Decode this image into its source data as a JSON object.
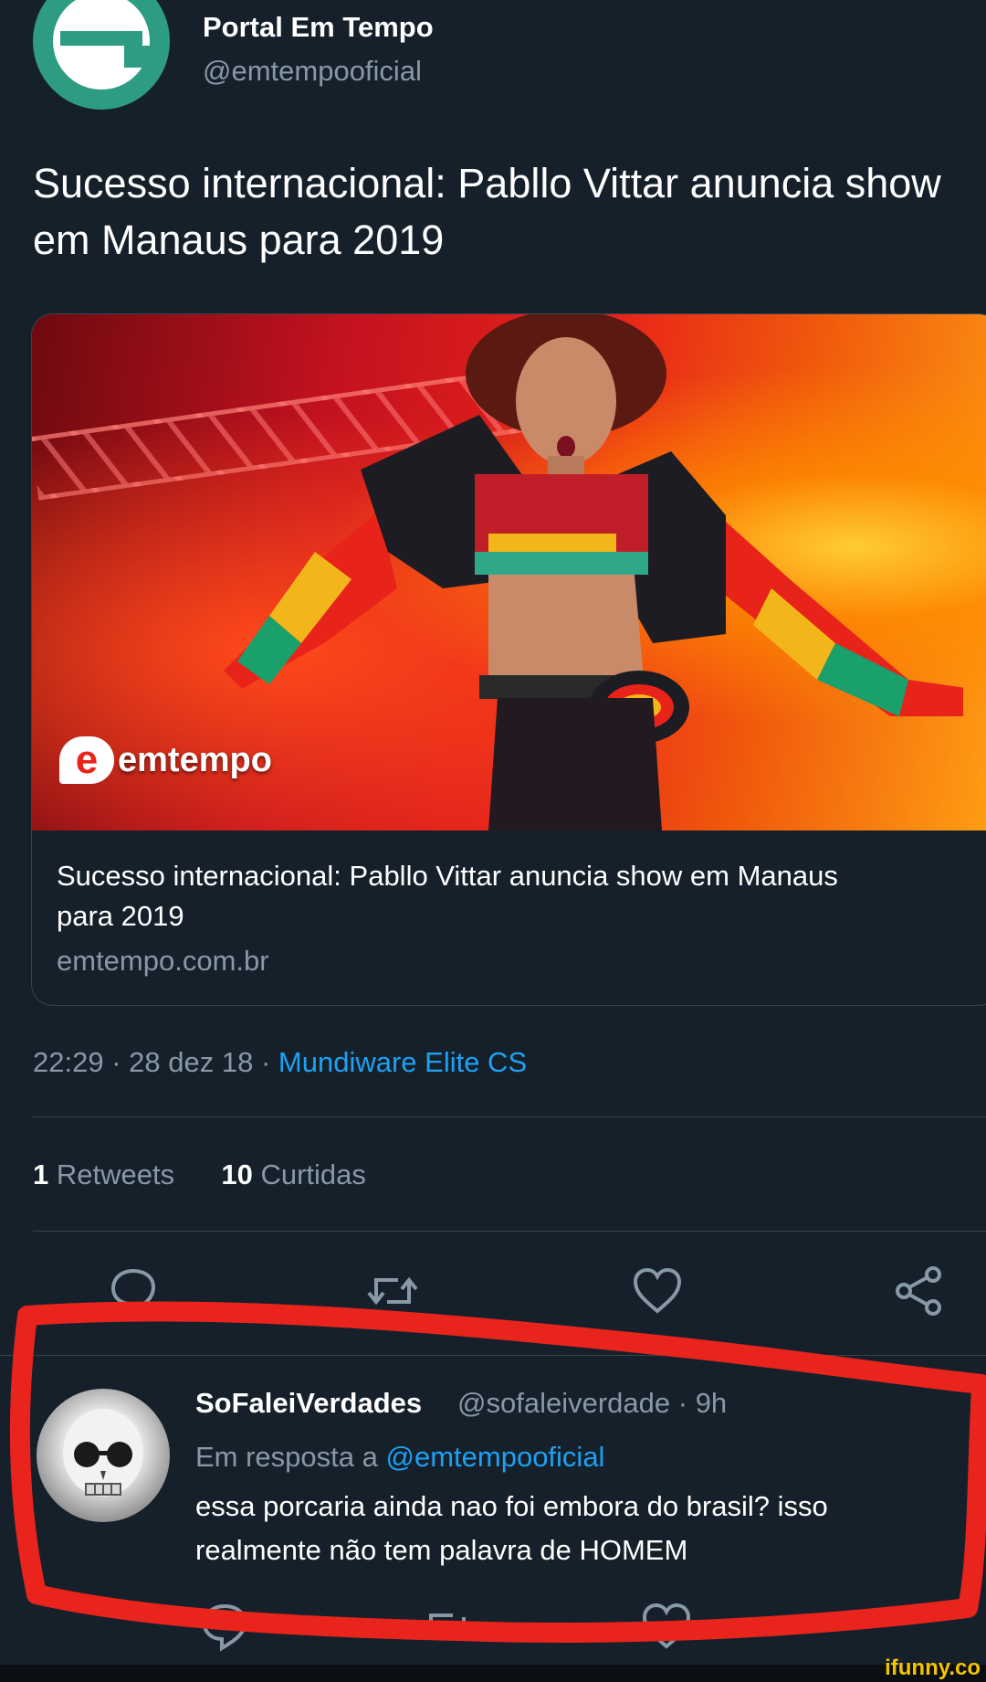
{
  "tweet": {
    "display_name": "Portal Em Tempo",
    "handle": "@emtempooficial",
    "text": "Sucesso internacional: Pabllo Vittar anuncia show em Manaus para 2019",
    "card": {
      "logo_badge": "e",
      "logo_text": "emtempo",
      "title": "Sucesso internacional: Pabllo Vittar anuncia show em Manaus para 2019",
      "domain": "emtempo.com.br"
    },
    "time": "22:29",
    "date": "28 dez 18",
    "source": "Mundiware Elite CS",
    "retweets_count": "1",
    "retweets_label": "Retweets",
    "likes_count": "10",
    "likes_label": "Curtidas"
  },
  "reply": {
    "display_name": "SoFaleiVerdades",
    "handle": "@sofaleiverdade",
    "age": "9h",
    "in_reply_to_prefix": "Em resposta a",
    "in_reply_to_handle": "@emtempooficial",
    "text": "essa porcaria ainda nao foi embora do brasil? isso realmente não tem palavra de HOMEM"
  },
  "watermark": "ifunny.co",
  "colors": {
    "background": "#15202b",
    "accent": "#1da1f2",
    "muted": "#8899a6",
    "highlight_outline": "#e8241c"
  },
  "icons": [
    "reply-icon",
    "retweet-icon",
    "like-icon",
    "share-icon"
  ]
}
